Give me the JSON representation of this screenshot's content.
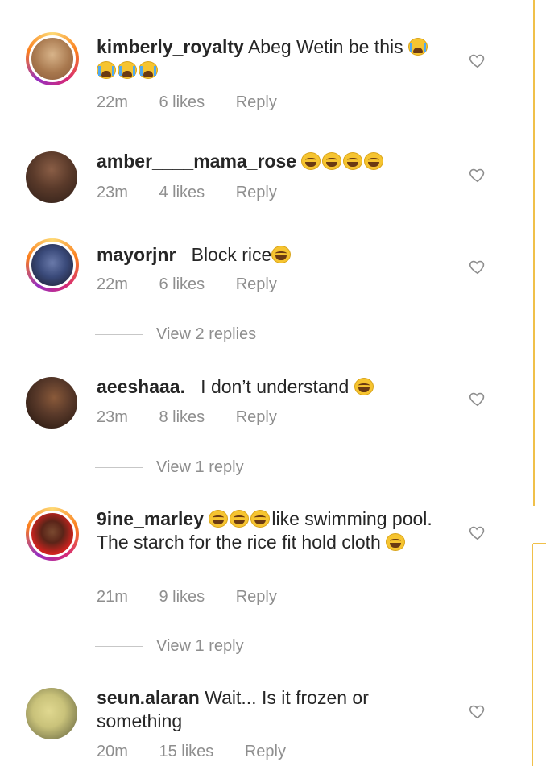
{
  "comments": [
    {
      "username": "kimberly_royalty",
      "text": "Abeg Wetin be this",
      "emojis": [
        "loudly-crying-face",
        "loudly-crying-face",
        "loudly-crying-face",
        "loudly-crying-face"
      ],
      "time": "22m",
      "likes": "6 likes",
      "reply_label": "Reply",
      "avatar_ring": true,
      "avatar_colors": [
        "#d8b48a",
        "#8a5a3a"
      ]
    },
    {
      "username": "amber____mama_rose",
      "text": "",
      "emojis": [
        "face-with-tears-of-joy",
        "face-with-tears-of-joy",
        "face-with-tears-of-joy",
        "face-with-tears-of-joy"
      ],
      "time": "23m",
      "likes": "4 likes",
      "reply_label": "Reply",
      "avatar_ring": false,
      "avatar_colors": [
        "#6b4a3a",
        "#2e1e18"
      ]
    },
    {
      "username": "mayorjnr_",
      "text": "Block rice",
      "emojis": [
        "face-with-tears-of-joy"
      ],
      "time": "22m",
      "likes": "6 likes",
      "reply_label": "Reply",
      "view_replies": "View 2 replies",
      "avatar_ring": true,
      "avatar_colors": [
        "#3a4a7a",
        "#1a1a2a"
      ]
    },
    {
      "username": "aeeshaaa._",
      "text": "I don’t understand",
      "emojis": [
        "face-with-tears-of-joy"
      ],
      "time": "23m",
      "likes": "8 likes",
      "reply_label": "Reply",
      "view_replies": "View 1 reply",
      "avatar_ring": false,
      "avatar_colors": [
        "#5a3a2a",
        "#1e120c"
      ]
    },
    {
      "username": "9ine_marley",
      "text_before": "",
      "text": "like swimming pool. The starch for the rice fit hold cloth",
      "emojis_inline": [
        "face-with-tears-of-joy",
        "face-with-tears-of-joy",
        "face-with-tears-of-joy"
      ],
      "emojis": [
        "face-with-tears-of-joy"
      ],
      "time": "21m",
      "likes": "9 likes",
      "reply_label": "Reply",
      "view_replies": "View 1 reply",
      "avatar_ring": true,
      "avatar_colors": [
        "#d0231f",
        "#5a2418"
      ]
    },
    {
      "username": "seun.alaran",
      "text": "Wait... Is it frozen or something",
      "emojis": [],
      "time": "20m",
      "likes": "15 likes",
      "reply_label": "Reply",
      "avatar_ring": false,
      "avatar_colors": [
        "#c9c27a",
        "#5a5a3a"
      ]
    }
  ],
  "icons": {
    "like": "heart-outline-icon"
  },
  "colors": {
    "accent_line": "#f0c04a",
    "meta_text": "#8e8e8e",
    "primary_text": "#262626"
  }
}
